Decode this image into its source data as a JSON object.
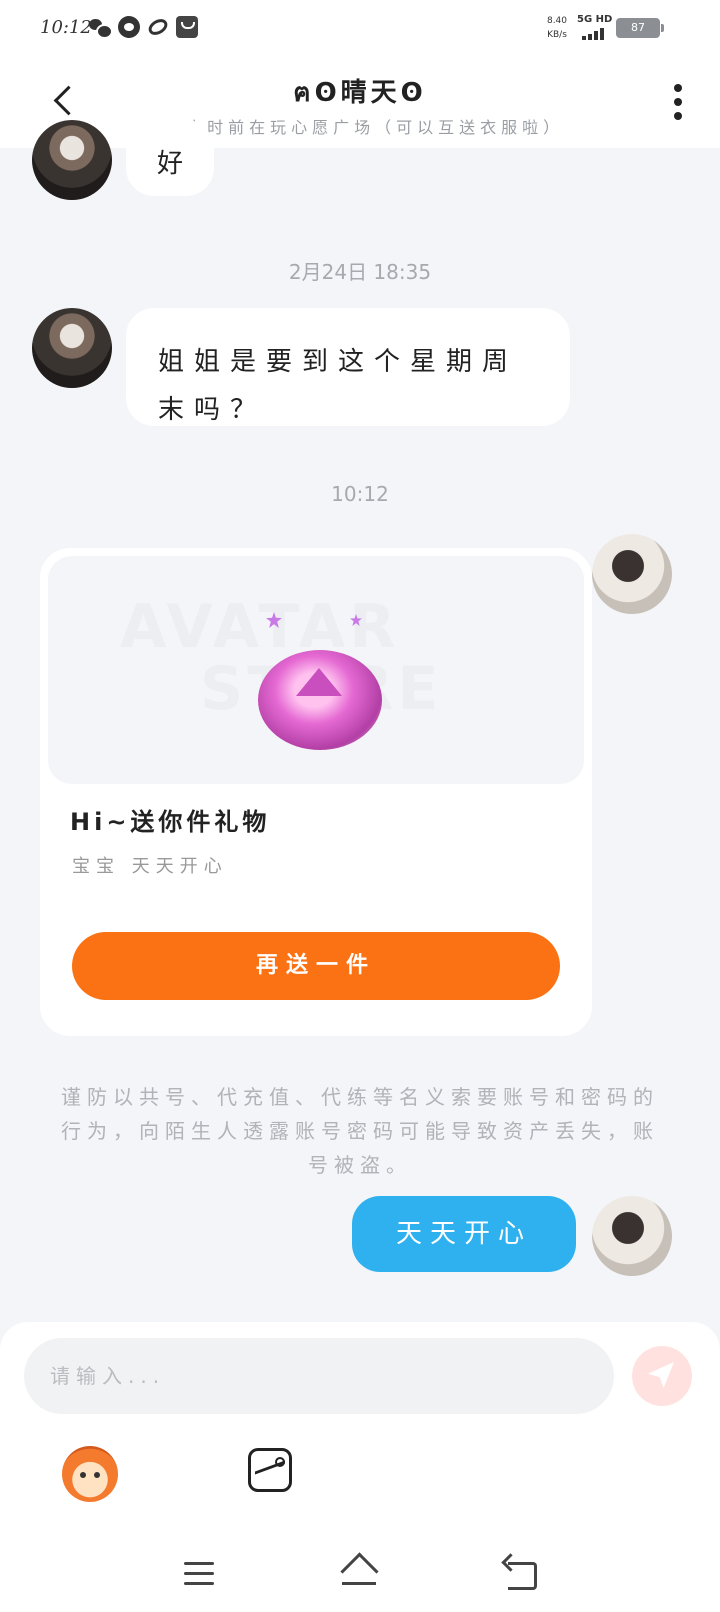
{
  "status_bar": {
    "time": "10:12",
    "net_speed_value": "8.40",
    "net_speed_unit": "KB/s",
    "network": "5G HD",
    "battery": "87"
  },
  "header": {
    "title": "ฅʘ晴天ʘ",
    "subtitle": "10小时前在玩心愿广场（可以互送衣服啦）"
  },
  "messages": [
    {
      "from": "other",
      "text": "好"
    },
    {
      "timestamp": "2月24日  18:35"
    },
    {
      "from": "other",
      "text": "姐姐是要到这个星期周末吗？"
    },
    {
      "timestamp": "10:12"
    }
  ],
  "gift_card": {
    "watermark_line1": "AVATAR",
    "watermark_line2": "STORE",
    "title": "Hi~送你件礼物",
    "description": "宝宝  天天开心",
    "button_label": "再送一件"
  },
  "security_notice": "谨防以共号、代充值、代练等名义索要账号和密码的行为，向陌生人透露账号密码可能导致资产丢失，账号被盗。",
  "my_message": "天天开心",
  "input": {
    "placeholder": "请输入..."
  }
}
